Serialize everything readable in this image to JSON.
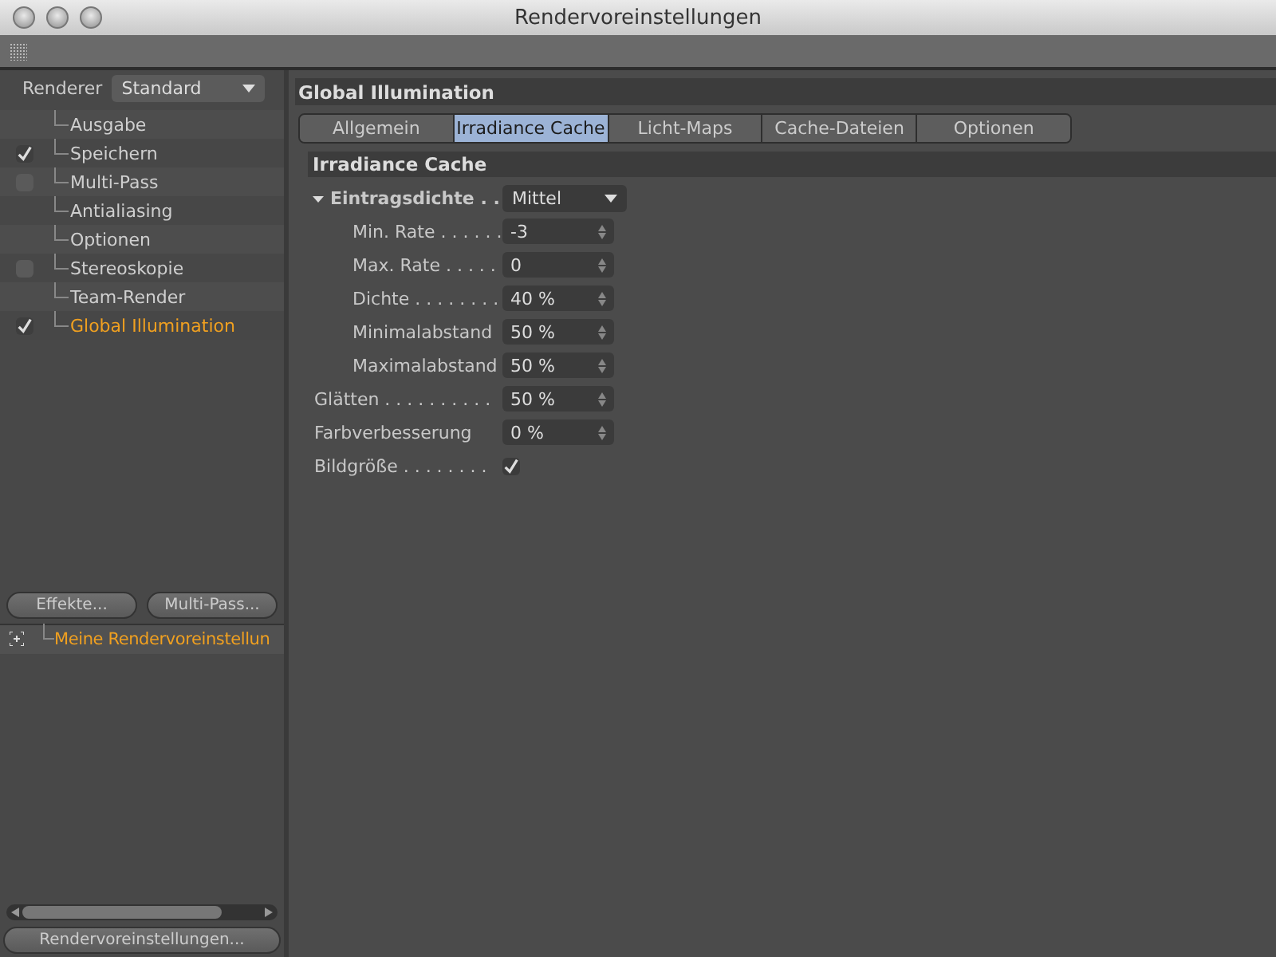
{
  "window": {
    "title": "Rendervoreinstellungen"
  },
  "renderer": {
    "label": "Renderer",
    "value": "Standard"
  },
  "settings": [
    {
      "label": "Ausgabe",
      "kind": "plain",
      "selected": false
    },
    {
      "label": "Speichern",
      "kind": "checkable",
      "checked": true,
      "selected": false
    },
    {
      "label": "Multi-Pass",
      "kind": "checkable",
      "checked": false,
      "selected": false
    },
    {
      "label": "Antialiasing",
      "kind": "plain",
      "selected": false
    },
    {
      "label": "Optionen",
      "kind": "plain",
      "selected": false
    },
    {
      "label": "Stereoskopie",
      "kind": "checkable",
      "checked": false,
      "selected": false
    },
    {
      "label": "Team-Render",
      "kind": "plain",
      "selected": false
    },
    {
      "label": "Global Illumination",
      "kind": "checkable",
      "checked": true,
      "selected": true
    }
  ],
  "left_buttons": [
    "Effekte...",
    "Multi-Pass..."
  ],
  "presets": [
    {
      "label": "Meine Rendervoreinstellun",
      "selected": true
    }
  ],
  "bottom_button": "Rendervoreinstellungen...",
  "panel": {
    "title": "Global Illumination",
    "tabs": [
      {
        "label": "Allgemein",
        "selected": false
      },
      {
        "label": "Irradiance Cache",
        "selected": true
      },
      {
        "label": "Licht-Maps",
        "selected": false
      },
      {
        "label": "Cache-Dateien",
        "selected": false
      },
      {
        "label": "Optionen",
        "selected": false
      }
    ],
    "section": "Irradiance Cache",
    "fields": [
      {
        "kind": "dropdown",
        "label": "Eintragsdichte . .",
        "value": "Mittel",
        "expanded": true,
        "indent": false
      },
      {
        "kind": "number",
        "label": "Min. Rate . . . . . .",
        "value": "-3",
        "indent": true
      },
      {
        "kind": "number",
        "label": "Max. Rate . . . . .",
        "value": "0",
        "indent": true
      },
      {
        "kind": "number",
        "label": "Dichte . . . . . . . .",
        "value": "40 %",
        "indent": true
      },
      {
        "kind": "number",
        "label": "Minimalabstand",
        "value": "50 %",
        "indent": true
      },
      {
        "kind": "number",
        "label": "Maximalabstand",
        "value": "50 %",
        "indent": true
      },
      {
        "kind": "number",
        "label": "Glätten . . . . . . . . . .",
        "value": "50 %",
        "indent": false
      },
      {
        "kind": "number",
        "label": "Farbverbesserung",
        "value": "0 %",
        "indent": false
      },
      {
        "kind": "checkbox",
        "label": "Bildgröße . . . . . . . .",
        "checked": true,
        "indent": false
      }
    ]
  }
}
